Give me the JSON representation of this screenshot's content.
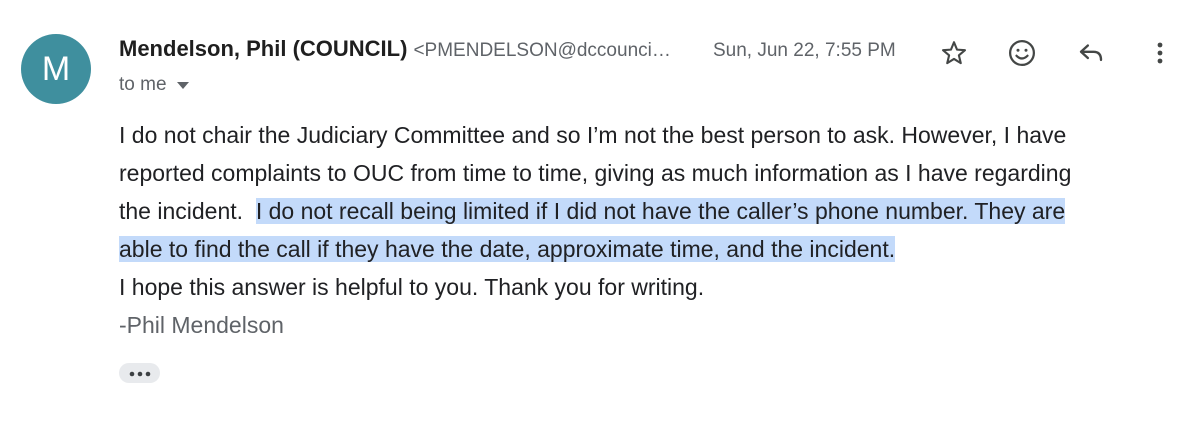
{
  "avatar": {
    "letter": "M",
    "color": "#3f8f9e"
  },
  "message": {
    "sender_name": "Mendelson, Phil (COUNCIL)",
    "sender_email": "<PMENDELSON@dccouncil.gov>",
    "date": "Sun, Jun 22, 7:55 PM",
    "recipient": "to me",
    "body": {
      "line1": "I do not chair the Judiciary Committee and so I’m not the best person to ask.  However, I have",
      "line2": "reported complaints to OUC from time to time, giving as much information as I have regarding",
      "line3_plain": "the incident.  ",
      "line3_highlight": "I do not recall being limited if I did not have the caller’s phone number.  They are",
      "line4_highlight": "able to find the call if they have the date, approximate time, and the incident.",
      "line5": "I hope this answer is helpful to you.  Thank you for writing.",
      "signature": "-Phil Mendelson"
    }
  },
  "toolbar": {
    "star": "star-icon",
    "emoji": "emoji-reaction-icon",
    "reply": "reply-icon",
    "more": "more-vertical-icon"
  },
  "colors": {
    "highlight": "#c3dafa",
    "avatar": "#3f8f9e",
    "secondary_text": "#5f6368"
  }
}
